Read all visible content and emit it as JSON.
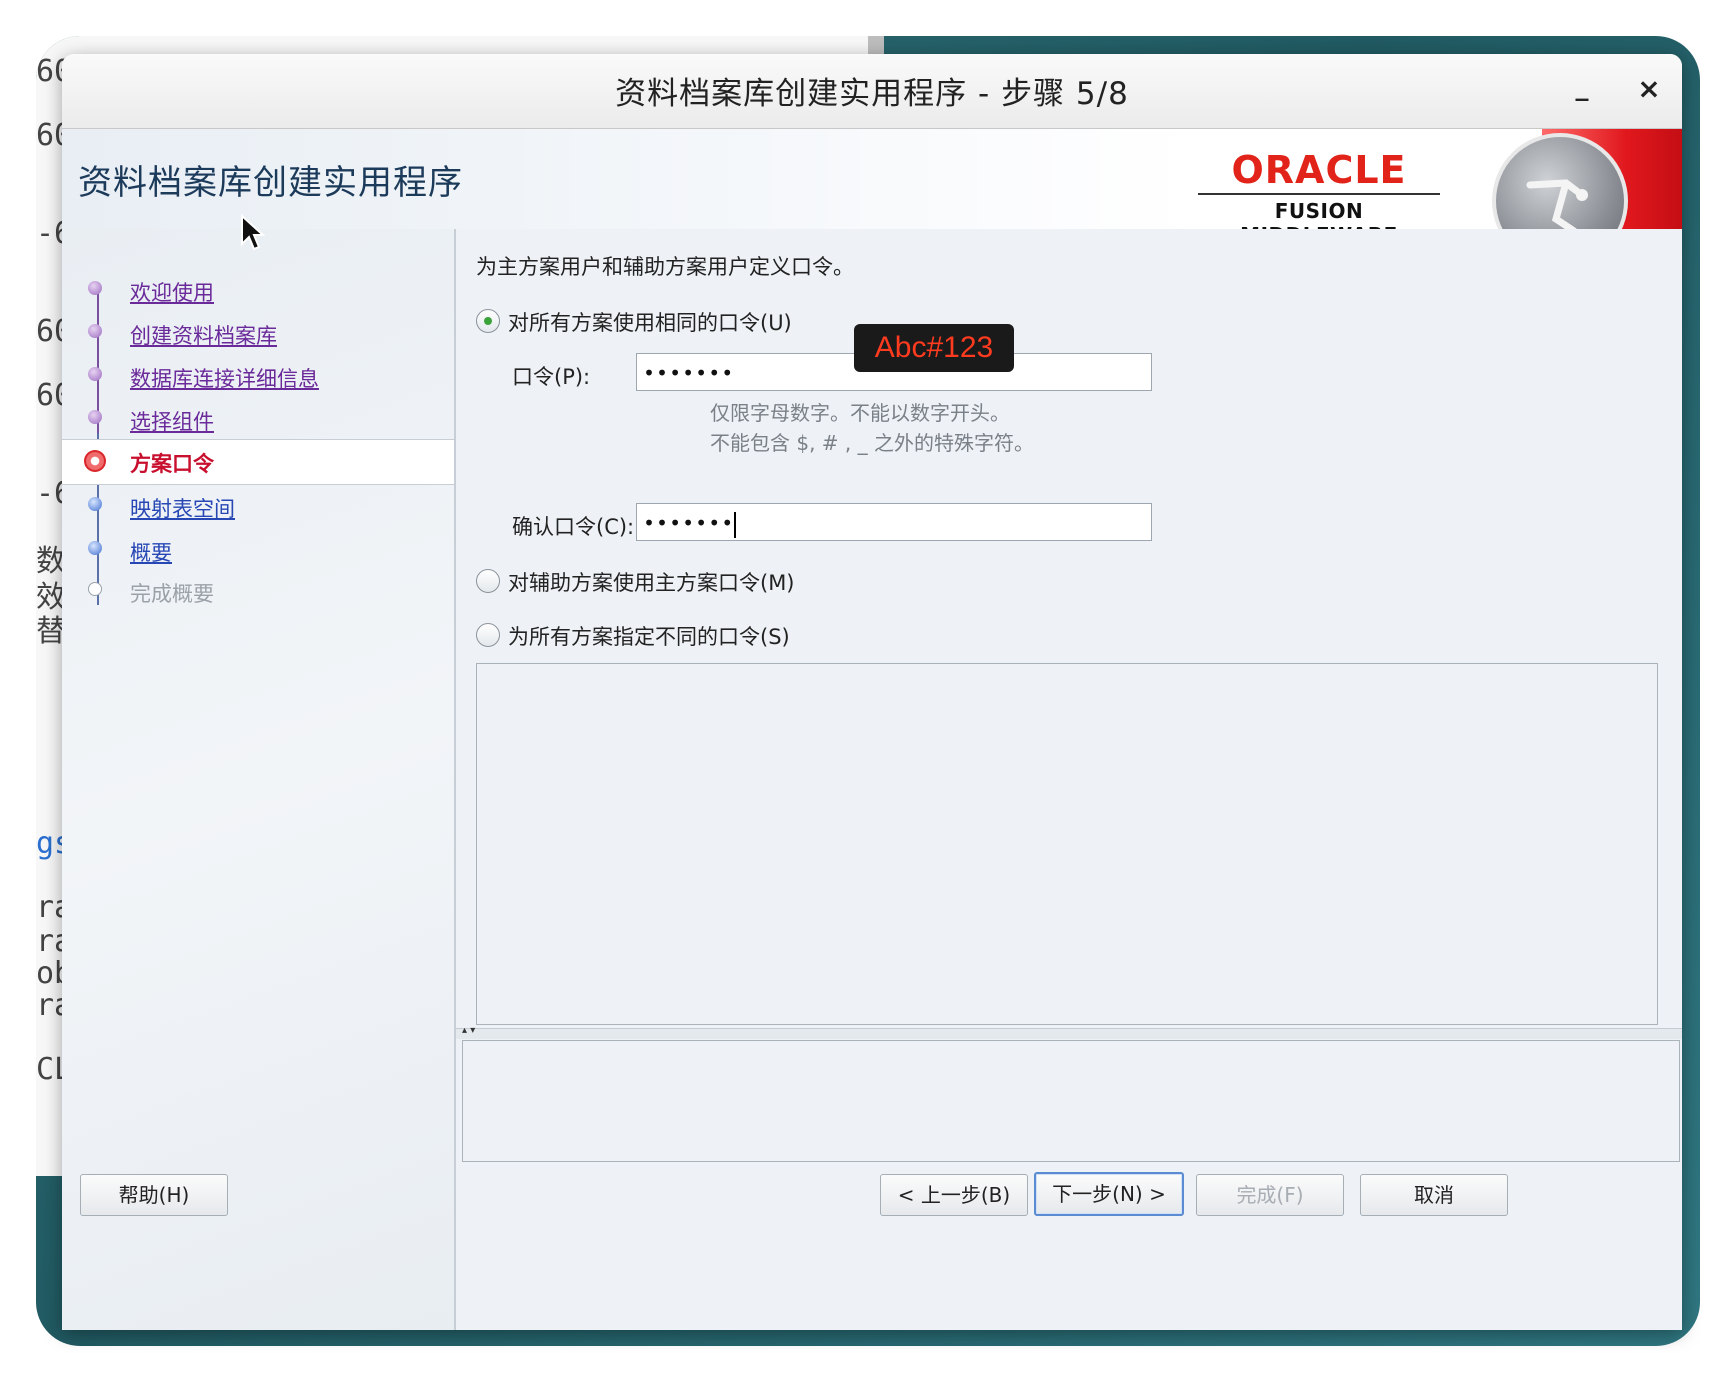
{
  "background": {
    "lines": [
      "60",
      "60",
      "-6",
      "60",
      "60",
      "-6",
      "数",
      "效",
      "替",
      "gs",
      "ra",
      "ra",
      "ob",
      "ra",
      "CL"
    ]
  },
  "window": {
    "title": "资料档案库创建实用程序 - 步骤 5/8",
    "minimize_glyph": "_",
    "close_glyph": "×"
  },
  "banner": {
    "app_title": "资料档案库创建实用程序",
    "logo_oracle": "ORACLE",
    "logo_sub": "FUSION MIDDLEWARE"
  },
  "nav": {
    "items": [
      {
        "label": "欢迎使用",
        "state": "visited"
      },
      {
        "label": "创建资料档案库",
        "state": "visited"
      },
      {
        "label": "数据库连接详细信息",
        "state": "visited"
      },
      {
        "label": "选择组件",
        "state": "visited"
      },
      {
        "label": "方案口令",
        "state": "current"
      },
      {
        "label": "映射表空间",
        "state": "available"
      },
      {
        "label": "概要",
        "state": "available"
      },
      {
        "label": "完成概要",
        "state": "disabled"
      }
    ]
  },
  "content": {
    "description": "为主方案用户和辅助方案用户定义口令。",
    "option_same": "对所有方案使用相同的口令(U)",
    "password_label": "口令(P):",
    "password_value": "•••••••",
    "hint_line1": "仅限字母数字。不能以数字开头。",
    "hint_line2": "不能包含 $, # , _ 之外的特殊字符。",
    "confirm_label": "确认口令(C):",
    "confirm_value": "•••••••",
    "option_aux": "对辅助方案使用主方案口令(M)",
    "option_diff": "为所有方案指定不同的口令(S)",
    "selected_option": "same",
    "annotation": "Abc#123"
  },
  "buttons": {
    "help": "帮助(H)",
    "back": "< 上一步(B)",
    "next": "下一步(N) >",
    "finish": "完成(F)",
    "cancel": "取消"
  },
  "colors": {
    "oracle_red": "#e2231a",
    "current_step": "#c8102e",
    "visited_link": "#6a2a9a",
    "available_link": "#2747b5"
  }
}
